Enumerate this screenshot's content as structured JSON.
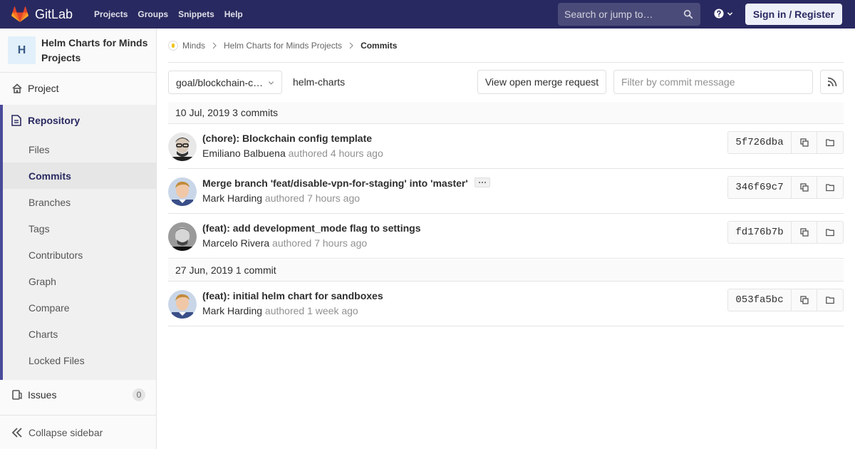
{
  "navbar": {
    "brand": "GitLab",
    "links": [
      "Projects",
      "Groups",
      "Snippets",
      "Help"
    ],
    "search_placeholder": "Search or jump to…",
    "sign_in": "Sign in / Register"
  },
  "sidebar": {
    "project_initial": "H",
    "project_name": "Helm Charts for Minds Projects",
    "project_label": "Project",
    "repository_label": "Repository",
    "repo_items": [
      "Files",
      "Commits",
      "Branches",
      "Tags",
      "Contributors",
      "Graph",
      "Compare",
      "Charts",
      "Locked Files"
    ],
    "active_item": "Commits",
    "issues_label": "Issues",
    "issues_count": "0",
    "collapse_label": "Collapse sidebar"
  },
  "breadcrumbs": {
    "group": "Minds",
    "project": "Helm Charts for Minds Projects",
    "current": "Commits"
  },
  "toolbar": {
    "branch": "goal/blockchain-c…",
    "path": "helm-charts",
    "merge_request_button": "View open merge request",
    "filter_placeholder": "Filter by commit message"
  },
  "days": [
    {
      "header": "10 Jul, 2019 3 commits",
      "commits": [
        {
          "title": "(chore): Blockchain config template",
          "author": "Emiliano Balbuena",
          "verb": "authored",
          "time": "4 hours ago",
          "sha": "5f726dba",
          "has_more": false
        },
        {
          "title": "Merge branch 'feat/disable-vpn-for-staging' into 'master'",
          "author": "Mark Harding",
          "verb": "authored",
          "time": "7 hours ago",
          "sha": "346f69c7",
          "has_more": true
        },
        {
          "title": "(feat): add development_mode flag to settings",
          "author": "Marcelo Rivera",
          "verb": "authored",
          "time": "7 hours ago",
          "sha": "fd176b7b",
          "has_more": false
        }
      ]
    },
    {
      "header": "27 Jun, 2019 1 commit",
      "commits": [
        {
          "title": "(feat): initial helm chart for sandboxes",
          "author": "Mark Harding",
          "verb": "authored",
          "time": "1 week ago",
          "sha": "053fa5bc",
          "has_more": false
        }
      ]
    }
  ],
  "colors": {
    "navbar": "#292961",
    "accent": "#4a4a9a",
    "sign_in_bg": "#eef0f9"
  }
}
